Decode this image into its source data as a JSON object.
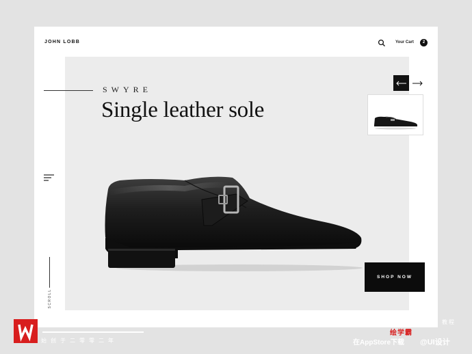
{
  "header": {
    "brand": "JOHN LOBB",
    "cart_label": "Your Cart",
    "cart_count": "2"
  },
  "product": {
    "collection": "SWYRE",
    "headline": "Single leather sole",
    "cta_label": "SHOP NOW"
  },
  "sidebar": {
    "scroll_label": "SCROLL"
  },
  "icons": {
    "search": "search-icon",
    "menu": "menu-icon",
    "prev": "arrow-left-icon",
    "next": "arrow-right-icon"
  },
  "colors": {
    "background": "#e3e3e3",
    "card": "#ffffff",
    "hero": "#ececec",
    "dark": "#0c0c0c",
    "watermark_red": "#d81e1e"
  },
  "watermark": {
    "slogan": "始创于二零零二年",
    "tutorial": "教程",
    "brand": "绘学霸",
    "appstore": "在AppStore下载",
    "weibo": "@UI设计"
  }
}
